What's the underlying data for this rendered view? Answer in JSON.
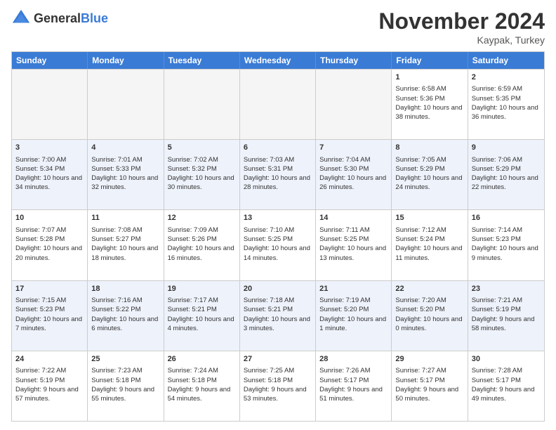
{
  "header": {
    "logo_general": "General",
    "logo_blue": "Blue",
    "month_title": "November 2024",
    "location": "Kaypak, Turkey"
  },
  "days_of_week": [
    "Sunday",
    "Monday",
    "Tuesday",
    "Wednesday",
    "Thursday",
    "Friday",
    "Saturday"
  ],
  "rows": [
    [
      {
        "day": "",
        "info": ""
      },
      {
        "day": "",
        "info": ""
      },
      {
        "day": "",
        "info": ""
      },
      {
        "day": "",
        "info": ""
      },
      {
        "day": "",
        "info": ""
      },
      {
        "day": "1",
        "info": "Sunrise: 6:58 AM\nSunset: 5:36 PM\nDaylight: 10 hours and 38 minutes."
      },
      {
        "day": "2",
        "info": "Sunrise: 6:59 AM\nSunset: 5:35 PM\nDaylight: 10 hours and 36 minutes."
      }
    ],
    [
      {
        "day": "3",
        "info": "Sunrise: 7:00 AM\nSunset: 5:34 PM\nDaylight: 10 hours and 34 minutes."
      },
      {
        "day": "4",
        "info": "Sunrise: 7:01 AM\nSunset: 5:33 PM\nDaylight: 10 hours and 32 minutes."
      },
      {
        "day": "5",
        "info": "Sunrise: 7:02 AM\nSunset: 5:32 PM\nDaylight: 10 hours and 30 minutes."
      },
      {
        "day": "6",
        "info": "Sunrise: 7:03 AM\nSunset: 5:31 PM\nDaylight: 10 hours and 28 minutes."
      },
      {
        "day": "7",
        "info": "Sunrise: 7:04 AM\nSunset: 5:30 PM\nDaylight: 10 hours and 26 minutes."
      },
      {
        "day": "8",
        "info": "Sunrise: 7:05 AM\nSunset: 5:29 PM\nDaylight: 10 hours and 24 minutes."
      },
      {
        "day": "9",
        "info": "Sunrise: 7:06 AM\nSunset: 5:29 PM\nDaylight: 10 hours and 22 minutes."
      }
    ],
    [
      {
        "day": "10",
        "info": "Sunrise: 7:07 AM\nSunset: 5:28 PM\nDaylight: 10 hours and 20 minutes."
      },
      {
        "day": "11",
        "info": "Sunrise: 7:08 AM\nSunset: 5:27 PM\nDaylight: 10 hours and 18 minutes."
      },
      {
        "day": "12",
        "info": "Sunrise: 7:09 AM\nSunset: 5:26 PM\nDaylight: 10 hours and 16 minutes."
      },
      {
        "day": "13",
        "info": "Sunrise: 7:10 AM\nSunset: 5:25 PM\nDaylight: 10 hours and 14 minutes."
      },
      {
        "day": "14",
        "info": "Sunrise: 7:11 AM\nSunset: 5:25 PM\nDaylight: 10 hours and 13 minutes."
      },
      {
        "day": "15",
        "info": "Sunrise: 7:12 AM\nSunset: 5:24 PM\nDaylight: 10 hours and 11 minutes."
      },
      {
        "day": "16",
        "info": "Sunrise: 7:14 AM\nSunset: 5:23 PM\nDaylight: 10 hours and 9 minutes."
      }
    ],
    [
      {
        "day": "17",
        "info": "Sunrise: 7:15 AM\nSunset: 5:23 PM\nDaylight: 10 hours and 7 minutes."
      },
      {
        "day": "18",
        "info": "Sunrise: 7:16 AM\nSunset: 5:22 PM\nDaylight: 10 hours and 6 minutes."
      },
      {
        "day": "19",
        "info": "Sunrise: 7:17 AM\nSunset: 5:21 PM\nDaylight: 10 hours and 4 minutes."
      },
      {
        "day": "20",
        "info": "Sunrise: 7:18 AM\nSunset: 5:21 PM\nDaylight: 10 hours and 3 minutes."
      },
      {
        "day": "21",
        "info": "Sunrise: 7:19 AM\nSunset: 5:20 PM\nDaylight: 10 hours and 1 minute."
      },
      {
        "day": "22",
        "info": "Sunrise: 7:20 AM\nSunset: 5:20 PM\nDaylight: 10 hours and 0 minutes."
      },
      {
        "day": "23",
        "info": "Sunrise: 7:21 AM\nSunset: 5:19 PM\nDaylight: 9 hours and 58 minutes."
      }
    ],
    [
      {
        "day": "24",
        "info": "Sunrise: 7:22 AM\nSunset: 5:19 PM\nDaylight: 9 hours and 57 minutes."
      },
      {
        "day": "25",
        "info": "Sunrise: 7:23 AM\nSunset: 5:18 PM\nDaylight: 9 hours and 55 minutes."
      },
      {
        "day": "26",
        "info": "Sunrise: 7:24 AM\nSunset: 5:18 PM\nDaylight: 9 hours and 54 minutes."
      },
      {
        "day": "27",
        "info": "Sunrise: 7:25 AM\nSunset: 5:18 PM\nDaylight: 9 hours and 53 minutes."
      },
      {
        "day": "28",
        "info": "Sunrise: 7:26 AM\nSunset: 5:17 PM\nDaylight: 9 hours and 51 minutes."
      },
      {
        "day": "29",
        "info": "Sunrise: 7:27 AM\nSunset: 5:17 PM\nDaylight: 9 hours and 50 minutes."
      },
      {
        "day": "30",
        "info": "Sunrise: 7:28 AM\nSunset: 5:17 PM\nDaylight: 9 hours and 49 minutes."
      }
    ]
  ]
}
